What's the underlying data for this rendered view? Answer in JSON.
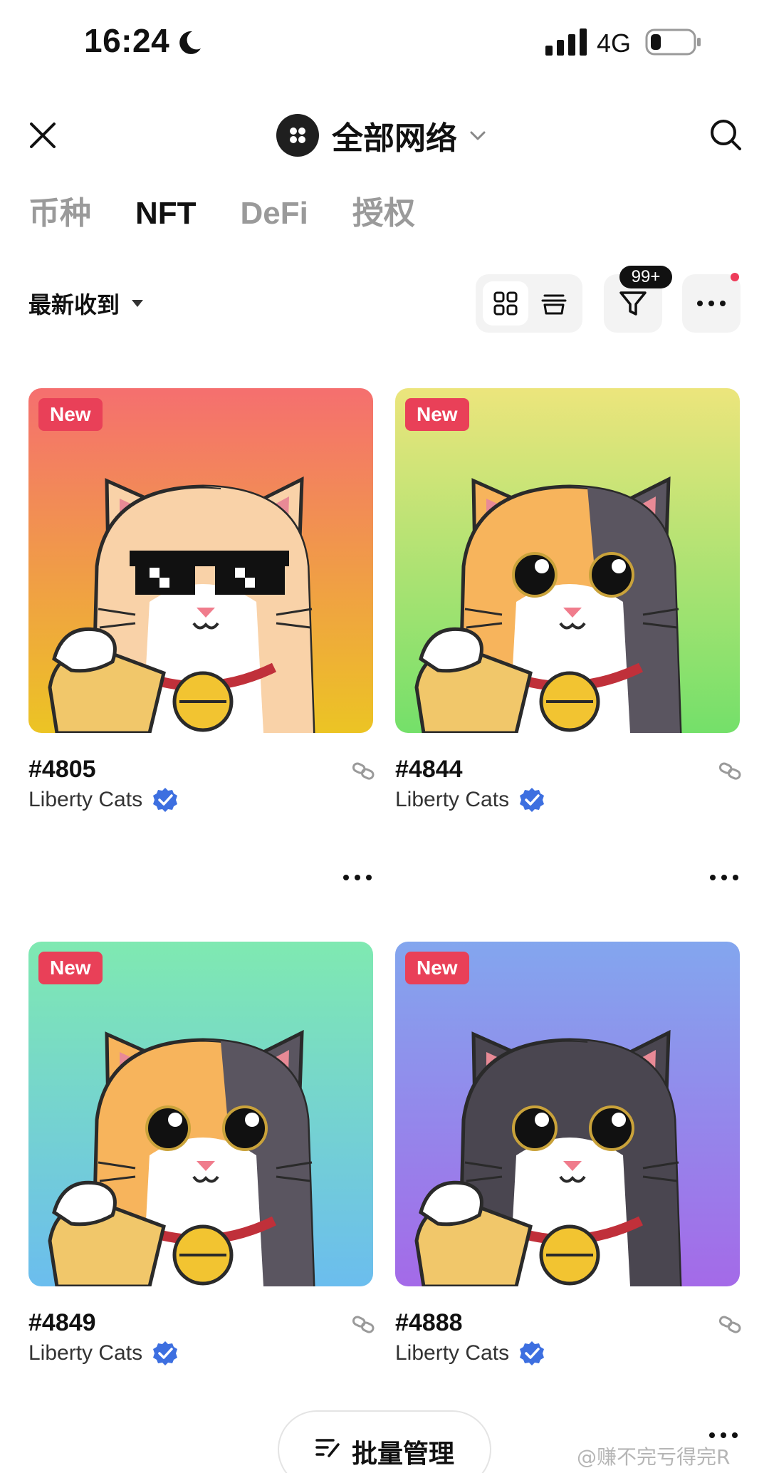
{
  "status_bar": {
    "time": "16:24",
    "network": "4G"
  },
  "header": {
    "network_title": "全部网络"
  },
  "tabs": [
    {
      "label": "币种",
      "active": false
    },
    {
      "label": "NFT",
      "active": true
    },
    {
      "label": "DeFi",
      "active": false
    },
    {
      "label": "授权",
      "active": false
    }
  ],
  "toolbar": {
    "sort_label": "最新收到",
    "filter_count": "99+"
  },
  "cards": [
    {
      "badge": "New",
      "id": "#4805",
      "collection": "Liberty Cats",
      "bg_top": "#f56f6f",
      "bg_bottom": "#ecc424",
      "fur": "#f9d2a8",
      "patch": "#f9d2a8",
      "accessory": "sunglasses"
    },
    {
      "badge": "New",
      "id": "#4844",
      "collection": "Liberty Cats",
      "bg_top": "#ece57c",
      "bg_bottom": "#74e06a",
      "fur": "#f7b45c",
      "patch": "#5a5560",
      "accessory": "eyes"
    },
    {
      "badge": "New",
      "id": "#4849",
      "collection": "Liberty Cats",
      "bg_top": "#7fe9b1",
      "bg_bottom": "#6bbdee",
      "fur": "#f7b45c",
      "patch": "#5a5560",
      "accessory": "eyes"
    },
    {
      "badge": "New",
      "id": "#4888",
      "collection": "Liberty Cats",
      "bg_top": "#83a6ee",
      "bg_bottom": "#a46ae8",
      "fur": "#4a4650",
      "patch": "#4a4650",
      "accessory": "eyes"
    }
  ],
  "bottom": {
    "batch_label": "批量管理"
  },
  "watermark": "@赚不完亏得完R",
  "colors": {
    "accent_badge": "#e94058",
    "verified": "#3d6fe0",
    "tab_inactive": "#9a9a9a"
  }
}
